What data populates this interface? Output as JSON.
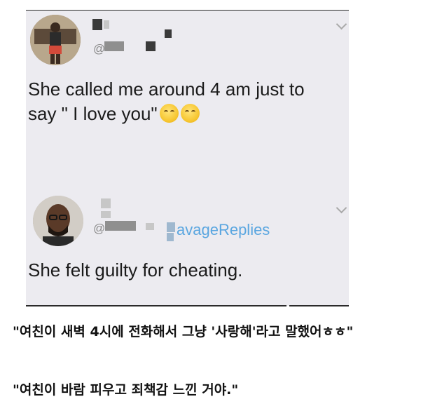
{
  "tweets": [
    {
      "handle": "@",
      "text_line1": "She called me around 4 am just to",
      "text_line2": "say \" I love you\"",
      "emojis": [
        "smiling-face-emoji",
        "smiling-face-emoji"
      ]
    },
    {
      "handle": "@",
      "handle_suffix": "avageReplies",
      "text": "She felt guilty for cheating."
    }
  ],
  "captions": [
    "\"여친이 새벽 4시에 전화해서 그냥 '사랑해'라고 말했어ㅎㅎ\"",
    "\"여친이 바람 피우고 죄책감 느낀 거야.\""
  ],
  "colors": {
    "tweet_background": "#ecebf0",
    "link_blue": "#5aa6e0",
    "text": "#1b1b1b"
  }
}
